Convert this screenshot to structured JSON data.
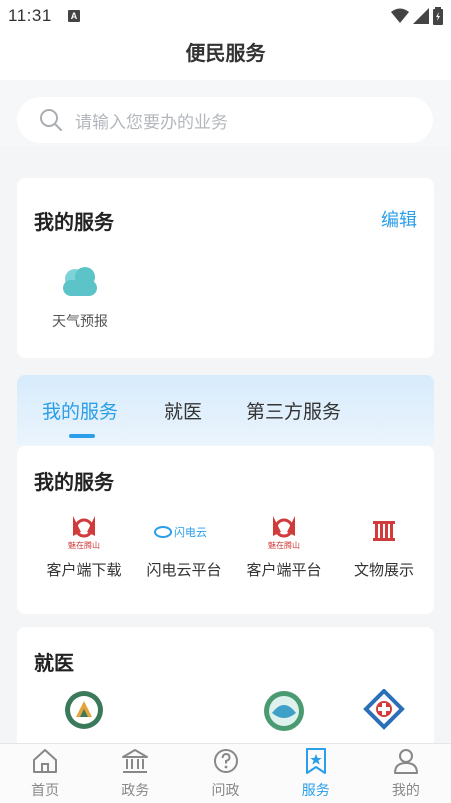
{
  "status": {
    "time": "11:31",
    "notif_glyph": "A"
  },
  "header": {
    "title": "便民服务"
  },
  "search": {
    "placeholder": "请输入您要办的业务",
    "icon": "search-icon"
  },
  "my_services_card": {
    "title": "我的服务",
    "edit_label": "编辑",
    "items": [
      {
        "label": "天气预报",
        "icon": "weather-cloud-icon"
      }
    ]
  },
  "tabs": [
    {
      "label": "我的服务",
      "active": true
    },
    {
      "label": "就医",
      "active": false
    },
    {
      "label": "第三方服务",
      "active": false
    }
  ],
  "services_section": {
    "title": "我的服务",
    "items": [
      {
        "label": "客户端下载",
        "logo_text": "魅在腾山",
        "icon": "app-logo-icon"
      },
      {
        "label": "闪电云平台",
        "logo_text": "闪电云",
        "icon": "lightning-cloud-icon"
      },
      {
        "label": "客户端平台",
        "logo_text": "魅在腾山",
        "icon": "app-logo-icon"
      },
      {
        "label": "文物展示",
        "icon": "relic-icon"
      }
    ]
  },
  "medical_section": {
    "title": "就医"
  },
  "tabbar": [
    {
      "label": "首页",
      "icon": "home-icon",
      "active": false
    },
    {
      "label": "政务",
      "icon": "government-icon",
      "active": false
    },
    {
      "label": "问政",
      "icon": "question-icon",
      "active": false
    },
    {
      "label": "服务",
      "icon": "service-bookmark-icon",
      "active": true
    },
    {
      "label": "我的",
      "icon": "user-icon",
      "active": false
    }
  ],
  "colors": {
    "accent": "#2a9ee8",
    "weather": "#5cc3c9",
    "logo_red": "#d23b3b"
  }
}
